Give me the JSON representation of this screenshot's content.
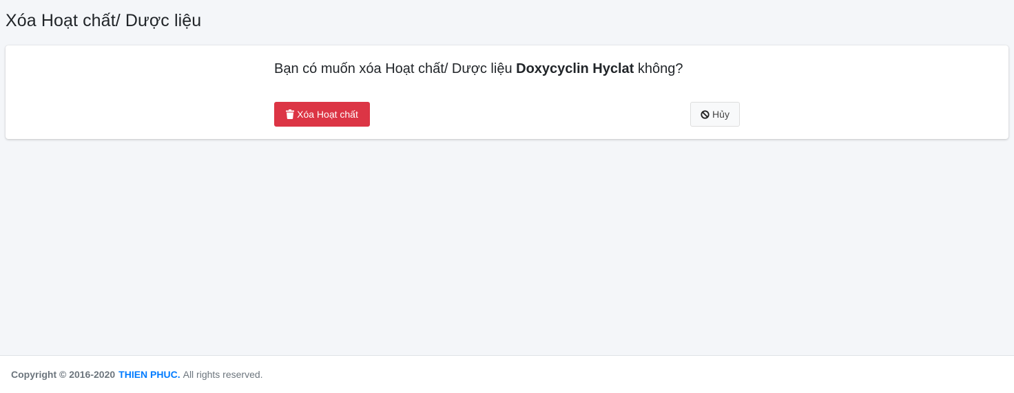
{
  "header": {
    "title": "Xóa Hoạt chất/ Dược liệu"
  },
  "confirm": {
    "prefix": "Bạn có muốn xóa Hoạt chất/ Dược liệu ",
    "item_name": "Doxycyclin Hyclat",
    "suffix": " không?"
  },
  "actions": {
    "delete_label": "Xóa Hoạt chất",
    "delete_icon": "trash-icon",
    "cancel_label": "Hủy",
    "cancel_icon": "ban-icon"
  },
  "footer": {
    "copyright": "Copyright © 2016-2020",
    "company": "THIEN PHUC.",
    "rights": "All rights reserved."
  },
  "colors": {
    "danger": "#dc3545",
    "link": "#007bff",
    "background": "#f4f6f9"
  }
}
